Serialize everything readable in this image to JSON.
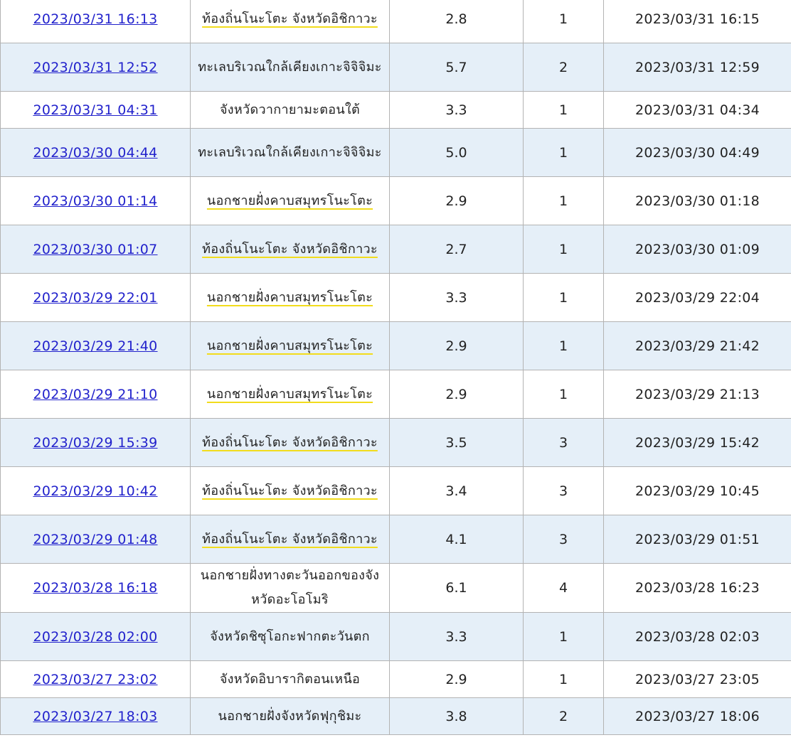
{
  "rows": [
    {
      "time": "2023/03/31 16:13",
      "place": "ท้องถิ่นโนะโตะ จังหวัดอิชิกาวะ",
      "mag": "2.8",
      "intensity": "1",
      "report": "2023/03/31 16:15",
      "highlight": true
    },
    {
      "time": "2023/03/31 12:52",
      "place": "ทะเลบริเวณใกล้เคียงเกาะจิจิจิมะ",
      "mag": "5.7",
      "intensity": "2",
      "report": "2023/03/31 12:59",
      "highlight": false
    },
    {
      "time": "2023/03/31 04:31",
      "place": "จังหวัดวากายามะตอนใต้",
      "mag": "3.3",
      "intensity": "1",
      "report": "2023/03/31 04:34",
      "highlight": false
    },
    {
      "time": "2023/03/30 04:44",
      "place": "ทะเลบริเวณใกล้เคียงเกาะจิจิจิมะ",
      "mag": "5.0",
      "intensity": "1",
      "report": "2023/03/30 04:49",
      "highlight": false
    },
    {
      "time": "2023/03/30 01:14",
      "place": "นอกชายฝั่งคาบสมุทรโนะโตะ",
      "mag": "2.9",
      "intensity": "1",
      "report": "2023/03/30 01:18",
      "highlight": true
    },
    {
      "time": "2023/03/30 01:07",
      "place": "ท้องถิ่นโนะโตะ จังหวัดอิชิกาวะ",
      "mag": "2.7",
      "intensity": "1",
      "report": "2023/03/30 01:09",
      "highlight": true
    },
    {
      "time": "2023/03/29 22:01",
      "place": "นอกชายฝั่งคาบสมุทรโนะโตะ",
      "mag": "3.3",
      "intensity": "1",
      "report": "2023/03/29 22:04",
      "highlight": true
    },
    {
      "time": "2023/03/29 21:40",
      "place": "นอกชายฝั่งคาบสมุทรโนะโตะ",
      "mag": "2.9",
      "intensity": "1",
      "report": "2023/03/29 21:42",
      "highlight": true
    },
    {
      "time": "2023/03/29 21:10",
      "place": "นอกชายฝั่งคาบสมุทรโนะโตะ",
      "mag": "2.9",
      "intensity": "1",
      "report": "2023/03/29 21:13",
      "highlight": true
    },
    {
      "time": "2023/03/29 15:39",
      "place": "ท้องถิ่นโนะโตะ จังหวัดอิชิกาวะ",
      "mag": "3.5",
      "intensity": "3",
      "report": "2023/03/29 15:42",
      "highlight": true
    },
    {
      "time": "2023/03/29 10:42",
      "place": "ท้องถิ่นโนะโตะ จังหวัดอิชิกาวะ",
      "mag": "3.4",
      "intensity": "3",
      "report": "2023/03/29 10:45",
      "highlight": true
    },
    {
      "time": "2023/03/29 01:48",
      "place": "ท้องถิ่นโนะโตะ จังหวัดอิชิกาวะ",
      "mag": "4.1",
      "intensity": "3",
      "report": "2023/03/29 01:51",
      "highlight": true
    },
    {
      "time": "2023/03/28 16:18",
      "place": "นอกชายฝั่งทางตะวันออกของจังหวัดอะโอโมริ",
      "mag": "6.1",
      "intensity": "4",
      "report": "2023/03/28 16:23",
      "highlight": false
    },
    {
      "time": "2023/03/28 02:00",
      "place": "จังหวัดชิซุโอกะฟากตะวันตก",
      "mag": "3.3",
      "intensity": "1",
      "report": "2023/03/28 02:03",
      "highlight": false
    },
    {
      "time": "2023/03/27 23:02",
      "place": "จังหวัดอิบารากิตอนเหนือ",
      "mag": "2.9",
      "intensity": "1",
      "report": "2023/03/27 23:05",
      "highlight": false
    },
    {
      "time": "2023/03/27 18:03",
      "place": "นอกชายฝั่งจังหวัดฟุกุชิมะ",
      "mag": "3.8",
      "intensity": "2",
      "report": "2023/03/27 18:06",
      "highlight": false
    }
  ],
  "colors": {
    "link": "#2222cc",
    "row_alt": "#e5eff8",
    "border": "#b3b3b3",
    "highlight_underline": "#f2dc1c"
  }
}
